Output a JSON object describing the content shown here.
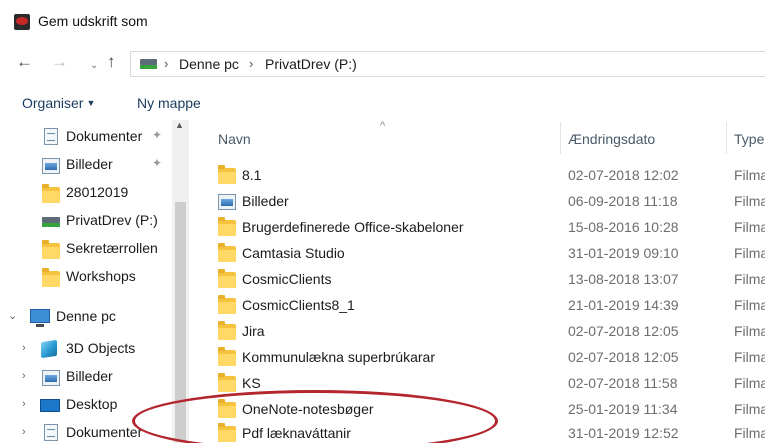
{
  "window": {
    "title": "Gem udskrift som",
    "icon": "app-print-icon"
  },
  "nav": {
    "back": "←",
    "forward": "→",
    "recent": "⌄",
    "up": "↑",
    "breadcrumb": [
      "Denne pc",
      "PrivatDrev (P:)"
    ],
    "separator": "›"
  },
  "toolbar": {
    "organize": "Organiser",
    "organize_caret": "▼",
    "new_folder": "Ny mappe"
  },
  "sidebar": {
    "quick_access": [
      {
        "label": "Dokumenter",
        "icon": "documents-icon",
        "pinned": true
      },
      {
        "label": "Billeder",
        "icon": "pictures-icon",
        "pinned": true
      },
      {
        "label": "28012019",
        "icon": "folder-icon",
        "pinned": false
      },
      {
        "label": "PrivatDrev (P:)",
        "icon": "network-drive-icon",
        "pinned": false
      },
      {
        "label": "Sekretærrollen",
        "icon": "folder-icon",
        "pinned": false
      },
      {
        "label": "Workshops",
        "icon": "folder-icon",
        "pinned": false
      }
    ],
    "this_pc": {
      "label": "Denne pc",
      "expander": "⌄",
      "icon": "computer-icon"
    },
    "this_pc_children": [
      {
        "label": "3D Objects",
        "icon": "3d-objects-icon",
        "expander": "›"
      },
      {
        "label": "Billeder",
        "icon": "pictures-icon",
        "expander": "›"
      },
      {
        "label": "Desktop",
        "icon": "desktop-icon",
        "expander": "›"
      },
      {
        "label": "Dokumenter",
        "icon": "documents-icon",
        "expander": "›"
      }
    ],
    "pin_glyph": "📌"
  },
  "columns": {
    "name": "Navn",
    "date": "Ændringsdato",
    "type": "Type",
    "sort_indicator": "^"
  },
  "files": [
    {
      "name": "8.1",
      "date": "02-07-2018 12:02",
      "type": "Filma",
      "icon": "folder-icon"
    },
    {
      "name": "Billeder",
      "date": "06-09-2018 11:18",
      "type": "Filma",
      "icon": "pictures-icon"
    },
    {
      "name": "Brugerdefinerede Office-skabeloner",
      "date": "15-08-2016 10:28",
      "type": "Filma",
      "icon": "folder-icon"
    },
    {
      "name": "Camtasia Studio",
      "date": "31-01-2019 09:10",
      "type": "Filma",
      "icon": "folder-icon"
    },
    {
      "name": "CosmicClients",
      "date": "13-08-2018 13:07",
      "type": "Filma",
      "icon": "folder-icon"
    },
    {
      "name": "CosmicClients8_1",
      "date": "21-01-2019 14:39",
      "type": "Filma",
      "icon": "folder-icon"
    },
    {
      "name": "Jira",
      "date": "02-07-2018 12:05",
      "type": "Filma",
      "icon": "folder-icon"
    },
    {
      "name": "Kommunulækna superbrúkarar",
      "date": "02-07-2018 12:05",
      "type": "Filma",
      "icon": "folder-icon"
    },
    {
      "name": "KS",
      "date": "02-07-2018 11:58",
      "type": "Filma",
      "icon": "folder-icon"
    },
    {
      "name": "OneNote-notesbøger",
      "date": "25-01-2019 11:34",
      "type": "Filma",
      "icon": "folder-icon"
    },
    {
      "name": "Pdf læknaváttanir",
      "date": "31-01-2019 12:52",
      "type": "Filma",
      "icon": "folder-icon"
    }
  ],
  "colors": {
    "folder": "#f6c340",
    "annotation": "#b3262e",
    "accent": "#1a3a5e"
  }
}
